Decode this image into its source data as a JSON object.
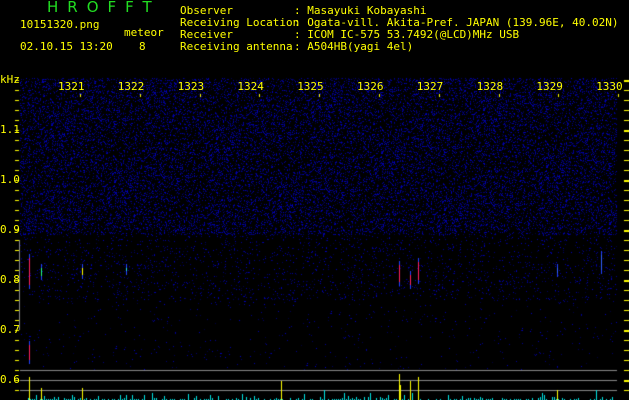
{
  "header": {
    "title": "HROFFT",
    "filename": "10151320.png",
    "datetime": "02.10.15 13:20",
    "meteor_label": "meteor",
    "meteor_count": "8",
    "info": [
      {
        "label": "Observer",
        "value": ": Masayuki Kobayashi"
      },
      {
        "label": "Receiving Location",
        "value": ": Ogata-vill. Akita-Pref. JAPAN (139.96E, 40.02N)"
      },
      {
        "label": "Receiver",
        "value": ": ICOM IC-575 53.7492(@LCD)MHz USB"
      },
      {
        "label": "Receiving antenna",
        "value": ": A504HB(yagi 4el)"
      }
    ]
  },
  "axes": {
    "y_unit": "kHz",
    "y_ticks": [
      "1.1",
      "1.0",
      "0.9",
      "0.8",
      "0.7",
      "0.6"
    ],
    "time_ticks": [
      "1321",
      "1322",
      "1323",
      "1324",
      "1325",
      "1326",
      "1327",
      "1328",
      "1329",
      "1330"
    ]
  },
  "colors": {
    "text": "#ffff00",
    "title": "#22dd22",
    "noise": "#1a1aa0",
    "histogram": "#00e5e5",
    "meteor_bar": "#ffff00",
    "gridline": "#888888"
  }
}
